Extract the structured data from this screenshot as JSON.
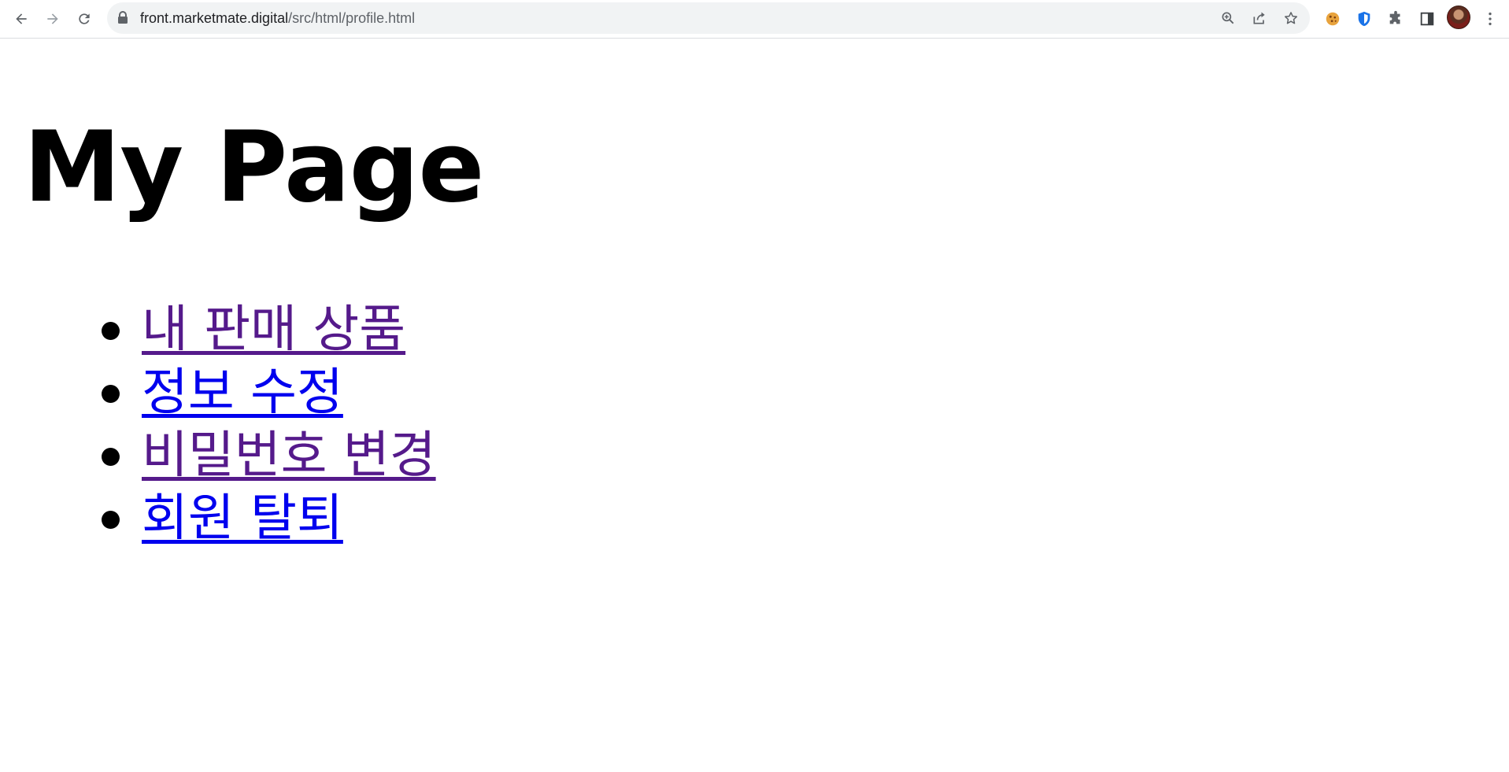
{
  "browser": {
    "url_host": "front.marketmate.digital",
    "url_path": "/src/html/profile.html",
    "icons": {
      "back": "arrow-left-icon",
      "forward": "arrow-right-icon",
      "reload": "reload-icon",
      "lock": "lock-icon",
      "zoom": "zoom-in-icon",
      "share": "share-icon",
      "bookmark": "star-icon",
      "cookie_extension": "cookie-icon",
      "shield_extension": "shield-icon",
      "extensions": "puzzle-icon",
      "side_panel": "side-panel-icon",
      "profile": "avatar-icon",
      "menu": "kebab-menu-icon"
    }
  },
  "page": {
    "title": "My Page",
    "menu": [
      {
        "label": "내 판매 상품",
        "visited": true
      },
      {
        "label": "정보 수정",
        "visited": false
      },
      {
        "label": "비밀번호 변경",
        "visited": true
      },
      {
        "label": "회원 탈퇴",
        "visited": false
      }
    ]
  },
  "colors": {
    "link_unvisited": "#0000ee",
    "link_visited": "#551a8b",
    "text": "#000000"
  }
}
